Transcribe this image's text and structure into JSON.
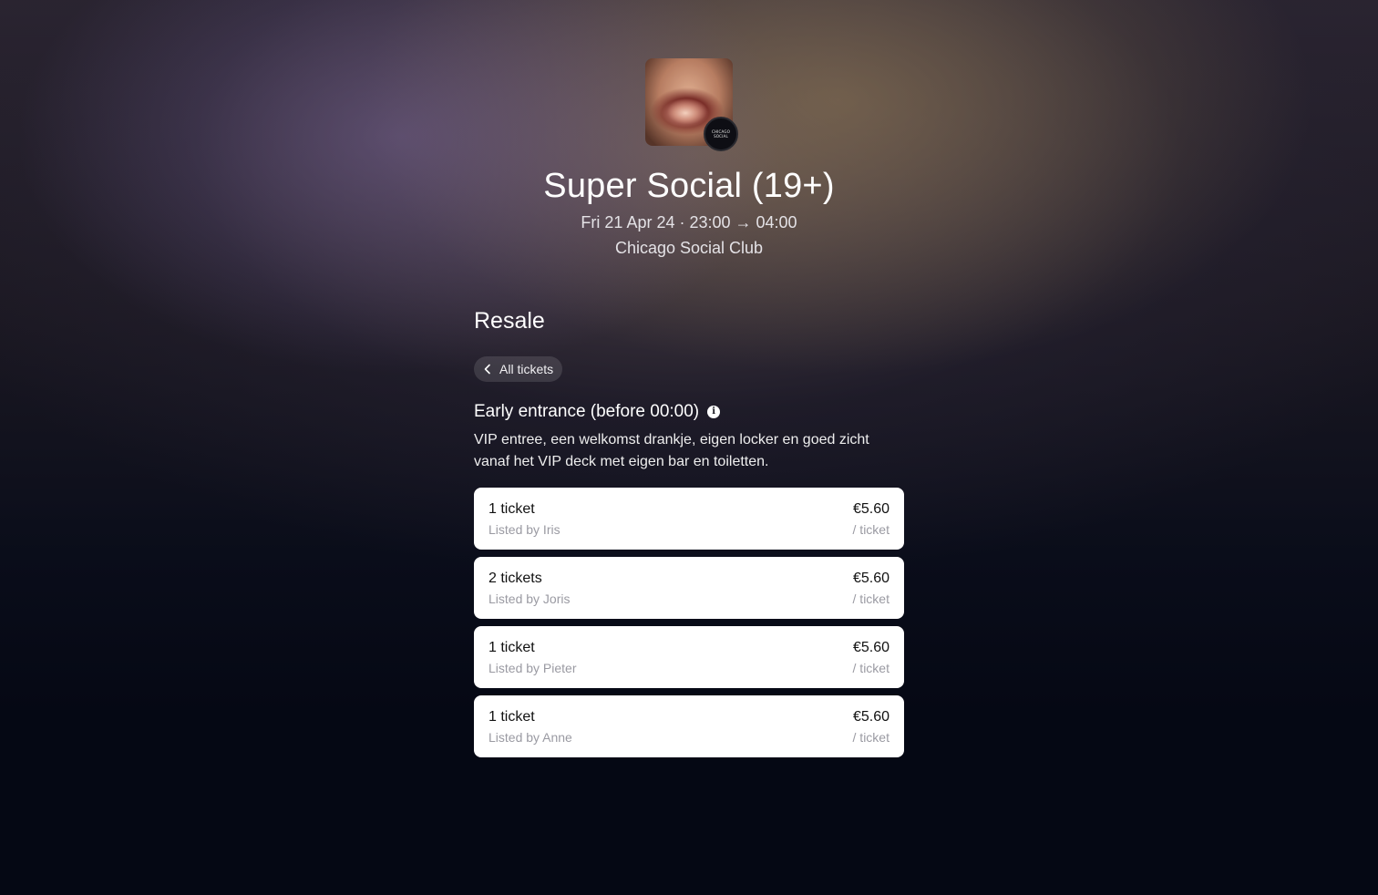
{
  "event": {
    "image_alt": "event artwork",
    "organizer_logo_text": "CHICAGO SOCIAL",
    "title": "Super Social (19+)",
    "datetime": "Fri 21 Apr 24 · 23:00 → 04:00",
    "venue": "Chicago Social Club"
  },
  "resale": {
    "section_title": "Resale",
    "back_label": "All tickets",
    "ticket_type": "Early entrance (before 00:00)",
    "description": "VIP entree, een welkomst drankje, eigen locker en goed zicht vanaf het VIP deck met eigen bar en toiletten.",
    "listings": [
      {
        "quantity": "1 ticket",
        "seller": "Listed by Iris",
        "price": "€5.60",
        "unit": "/ ticket"
      },
      {
        "quantity": "2 tickets",
        "seller": "Listed by Joris",
        "price": "€5.60",
        "unit": "/ ticket"
      },
      {
        "quantity": "1 ticket",
        "seller": "Listed by Pieter",
        "price": "€5.60",
        "unit": "/ ticket"
      },
      {
        "quantity": "1 ticket",
        "seller": "Listed by Anne",
        "price": "€5.60",
        "unit": "/ ticket"
      }
    ]
  },
  "icons": {
    "back": "chevron-left-icon",
    "info": "info-icon"
  }
}
